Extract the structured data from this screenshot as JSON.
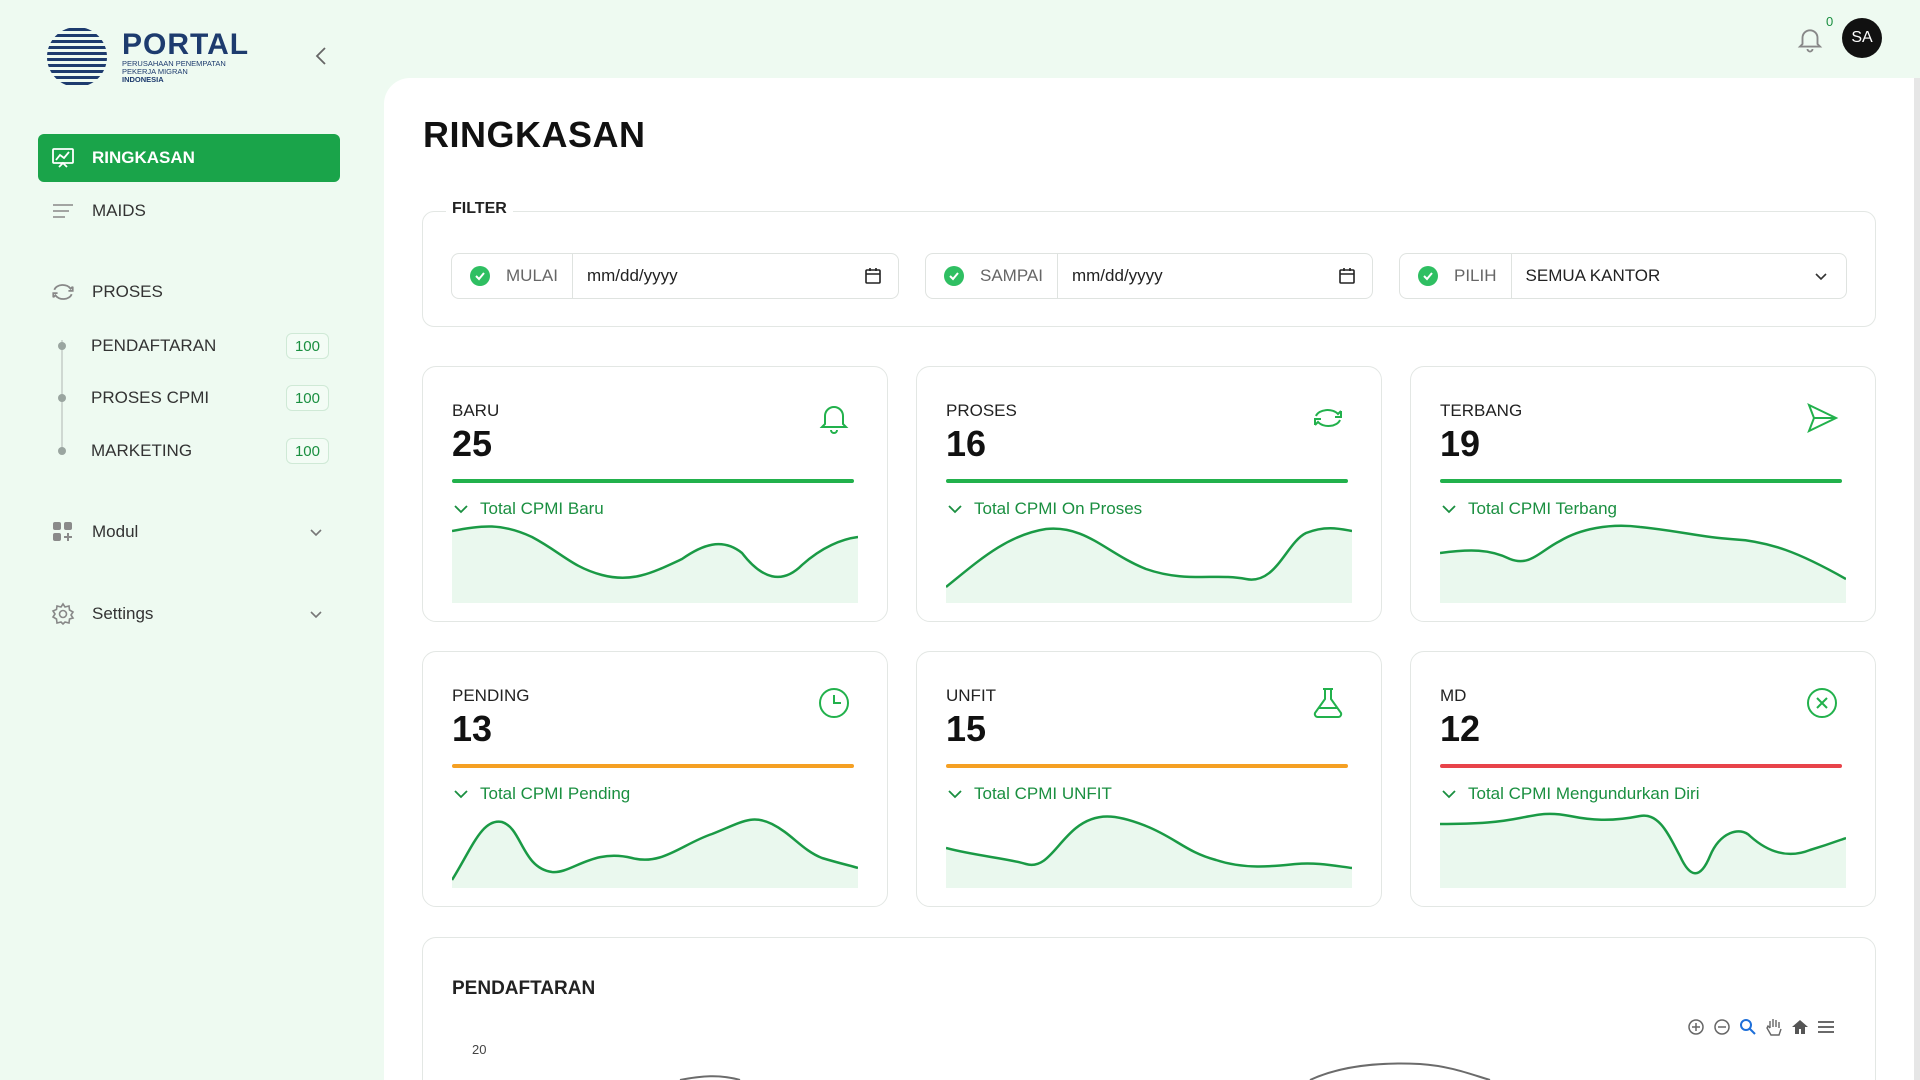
{
  "app": {
    "logo_title": "PORTAL",
    "logo_sub_line1": "PERUSAHAAN PENEMPATAN",
    "logo_sub_line2": "PEKERJA MIGRAN",
    "logo_sub_line3": "INDONESIA"
  },
  "sidebar": {
    "items": [
      {
        "label": "RINGKASAN",
        "icon": "presentation-chart-icon",
        "active": true
      },
      {
        "label": "MAIDS",
        "icon": "menu-lines-icon"
      },
      {
        "label": "PROSES",
        "icon": "refresh-icon"
      },
      {
        "label": "Modul",
        "icon": "grid-plus-icon"
      },
      {
        "label": "Settings",
        "icon": "gear-icon"
      }
    ],
    "sub_items": [
      {
        "label": "PENDAFTARAN",
        "badge": "100"
      },
      {
        "label": "PROSES CPMI",
        "badge": "100"
      },
      {
        "label": "MARKETING",
        "badge": "100"
      }
    ]
  },
  "header": {
    "notification_count": "0",
    "avatar_initials": "SA"
  },
  "page": {
    "title": "RINGKASAN"
  },
  "filter": {
    "legend": "FILTER",
    "start_label": "MULAI",
    "start_value": "mm/dd/yyyy",
    "end_label": "SAMPAI",
    "end_value": "mm/dd/yyyy",
    "office_label": "PILIH",
    "office_value": "SEMUA KANTOR"
  },
  "cards": [
    {
      "label": "BARU",
      "value": "25",
      "desc": "Total CPMI Baru",
      "icon": "bell-icon",
      "bar_color": "#22b14c"
    },
    {
      "label": "PROSES",
      "value": "16",
      "desc": "Total CPMI On Proses",
      "icon": "refresh-icon",
      "bar_color": "#22b14c"
    },
    {
      "label": "TERBANG",
      "value": "19",
      "desc": "Total CPMI Terbang",
      "icon": "send-icon",
      "bar_color": "#22b14c"
    },
    {
      "label": "PENDING",
      "value": "13",
      "desc": "Total CPMI Pending",
      "icon": "clock-icon",
      "bar_color": "#f5a023"
    },
    {
      "label": "UNFIT",
      "value": "15",
      "desc": "Total CPMI UNFIT",
      "icon": "flask-icon",
      "bar_color": "#f5a023"
    },
    {
      "label": "MD",
      "value": "12",
      "desc": "Total CPMI Mengundurkan Diri",
      "icon": "x-circle-icon",
      "bar_color": "#e8434a"
    }
  ],
  "registration": {
    "title": "PENDAFTARAN",
    "y_tick_top": "20"
  },
  "colors": {
    "primary_green": "#1aa44a",
    "sidebar_bg": "#eefaf1",
    "warning_orange": "#f5a023",
    "danger_red": "#e8434a"
  }
}
